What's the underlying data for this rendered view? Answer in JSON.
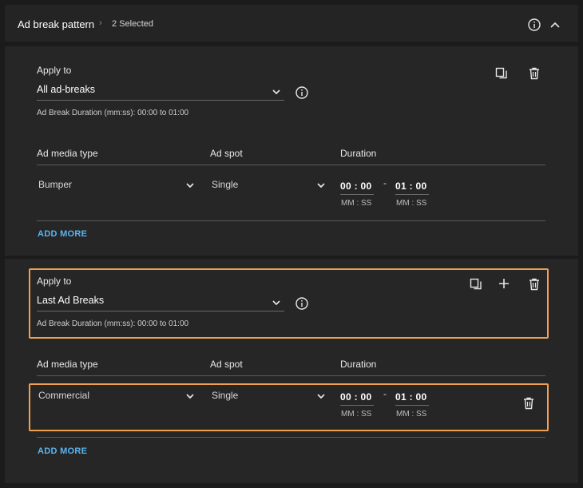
{
  "header": {
    "title": "Ad break pattern",
    "separator": "›",
    "selected": "2 Selected"
  },
  "rules": [
    {
      "apply_to_label": "Apply to",
      "apply_to_value": "All ad-breaks",
      "duration_note": "Ad Break Duration (mm:ss): 00:00 to 01:00",
      "columns": {
        "media": "Ad media type",
        "spot": "Ad spot",
        "duration": "Duration"
      },
      "rows": [
        {
          "media": "Bumper",
          "spot": "Single",
          "start": "00 : 00",
          "end": "01 : 00",
          "start_unit": "MM : SS",
          "end_unit": "MM : SS",
          "dash": "-"
        }
      ],
      "add_more": "ADD MORE"
    },
    {
      "apply_to_label": "Apply to",
      "apply_to_value": "Last Ad Breaks",
      "duration_note": "Ad Break Duration (mm:ss): 00:00 to 01:00",
      "columns": {
        "media": "Ad media type",
        "spot": "Ad spot",
        "duration": "Duration"
      },
      "rows": [
        {
          "media": "Commercial",
          "spot": "Single",
          "start": "00 : 00",
          "end": "01 : 00",
          "start_unit": "MM : SS",
          "end_unit": "MM : SS",
          "dash": "-"
        }
      ],
      "add_more": "ADD MORE"
    }
  ],
  "icons": {
    "info": "info-icon",
    "collapse": "chevron-up-icon",
    "copy": "copy-icon",
    "delete": "trash-icon",
    "add": "plus-icon",
    "dropdown": "chevron-down-icon"
  },
  "colors": {
    "background": "#1b1b1b",
    "card": "#262626",
    "highlight": "#f0a050",
    "link": "#5ab4f0"
  }
}
